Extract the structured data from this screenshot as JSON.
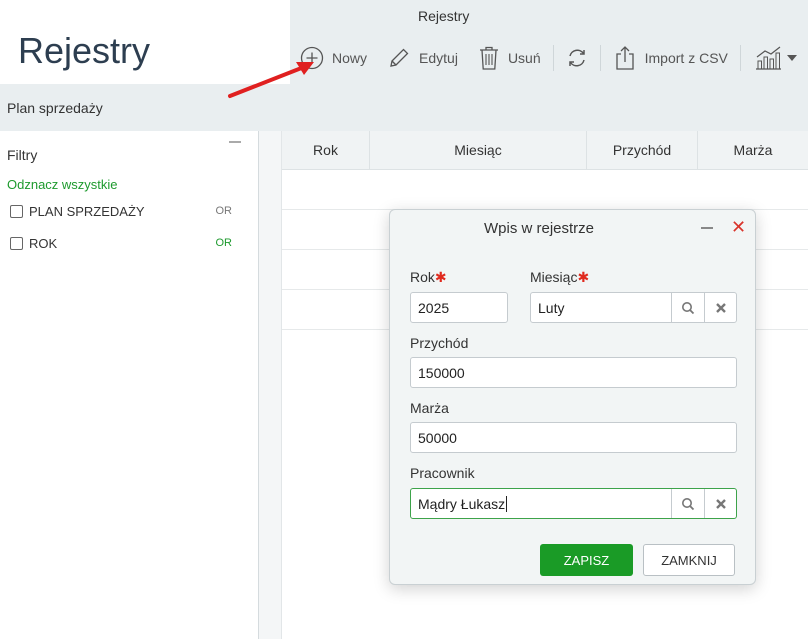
{
  "window_title": "Rejestry",
  "page_title": "Rejestry",
  "toolbar": {
    "new_label": "Nowy",
    "edit_label": "Edytuj",
    "delete_label": "Usuń",
    "import_label": "Import z CSV",
    "icons": [
      "plus-circle-icon",
      "pencil-icon",
      "trash-icon",
      "refresh-icon",
      "export-icon",
      "chart-icon"
    ]
  },
  "register_name": "Plan sprzedaży",
  "filters": {
    "title": "Filtry",
    "uncheck_all": "Odznacz wszystkie",
    "items": [
      {
        "label": "PLAN SPRZEDAŻY",
        "or": "OR",
        "or_color": "#777777"
      },
      {
        "label": "ROK",
        "or": "OR",
        "or_color": "#1e9a2e"
      }
    ]
  },
  "grid": {
    "columns": [
      "Rok",
      "Miesiąc",
      "Przychód",
      "Marża"
    ]
  },
  "modal": {
    "title": "Wpis w rejestrze",
    "year_label": "Rok",
    "year_value": "2025",
    "month_label": "Miesiąc",
    "month_value": "Luty",
    "revenue_label": "Przychód",
    "revenue_value": "150000",
    "margin_label": "Marża",
    "margin_value": "50000",
    "employee_label": "Pracownik",
    "employee_value": "Mądry Łukasz",
    "required_mark": "✱",
    "save_label": "ZAPISZ",
    "close_label": "ZAMKNIJ"
  },
  "colors": {
    "accent_green": "#1a9b26",
    "close_red": "#d9342b",
    "arrow_red": "#e02020"
  }
}
